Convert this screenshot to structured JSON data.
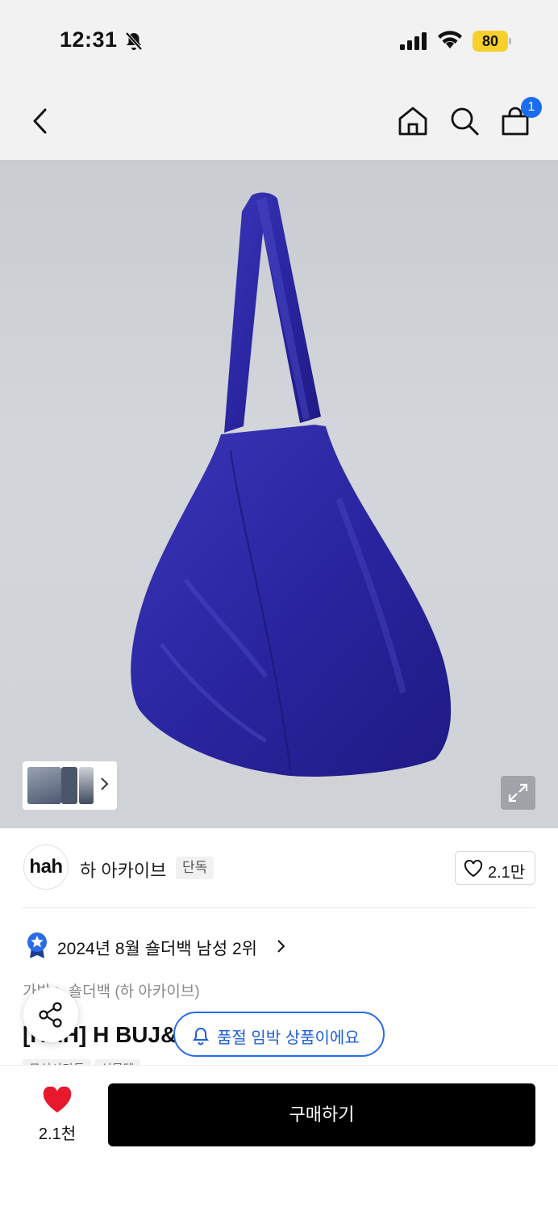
{
  "status_bar": {
    "time": "12:31",
    "battery": "80",
    "icons": [
      "bell-slash-icon",
      "signal-icon",
      "wifi-icon",
      "battery-icon"
    ]
  },
  "nav": {
    "icons": [
      "back-icon",
      "home-icon",
      "search-icon",
      "shopping-bag-icon"
    ],
    "cart_count": "1"
  },
  "product_image": {
    "thumbnail_icons": [
      "thumb-1",
      "thumb-2",
      "thumb-3"
    ],
    "bag_color": "#2f2aa6",
    "background_color": "#cfd2d6"
  },
  "brand": {
    "logo_text": "hah",
    "name": "하 아카이브",
    "tag": "단독",
    "like_count": "2.1만"
  },
  "ranking": {
    "text": "2024년 8월 숄더백 남성 2위"
  },
  "breadcrumb": "가방 > 숄더백 (하 아카이브)",
  "title": "[HAH] H BUJ&MOOD 숄더백 (블루)",
  "chips": [
    "무신사단독",
    "선물템"
  ],
  "soldout_banner": "품절 임박 상품이에요",
  "bottom_bar": {
    "favorite_count": "2.1천",
    "buy_label": "구매하기",
    "accent_color": "#e8192c"
  }
}
